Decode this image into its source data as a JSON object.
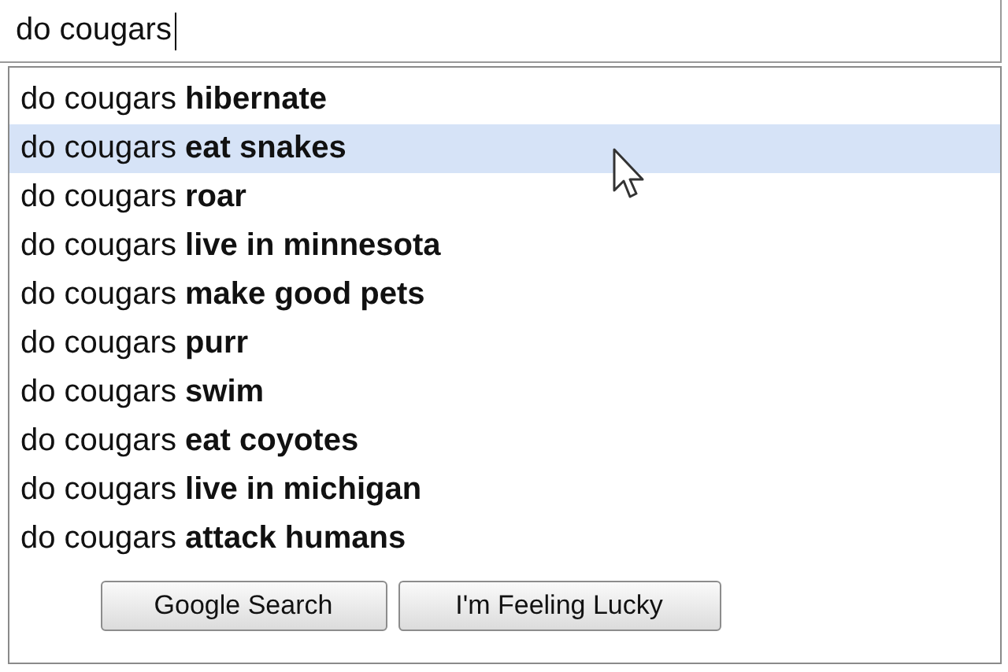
{
  "search": {
    "value": "do cougars"
  },
  "suggestions": [
    {
      "text": "do cougars **hibernate**",
      "selected": false
    },
    {
      "text": "do cougars **eat snakes**",
      "selected": true
    },
    {
      "text": "do cougars **roar**",
      "selected": false
    },
    {
      "text": "do cougars **live in minnesota**",
      "selected": false
    },
    {
      "text": "do cougars **make good pets**",
      "selected": false
    },
    {
      "text": "do cougars **purr**",
      "selected": false
    },
    {
      "text": "do cougars **swim**",
      "selected": false
    },
    {
      "text": "do cougars **eat coyotes**",
      "selected": false
    },
    {
      "text": "do cougars **live in michigan**",
      "selected": false
    },
    {
      "text": "do cougars **attack humans**",
      "selected": false
    }
  ],
  "buttons": [
    "Google Search",
    "I'm Feeling Lucky"
  ]
}
